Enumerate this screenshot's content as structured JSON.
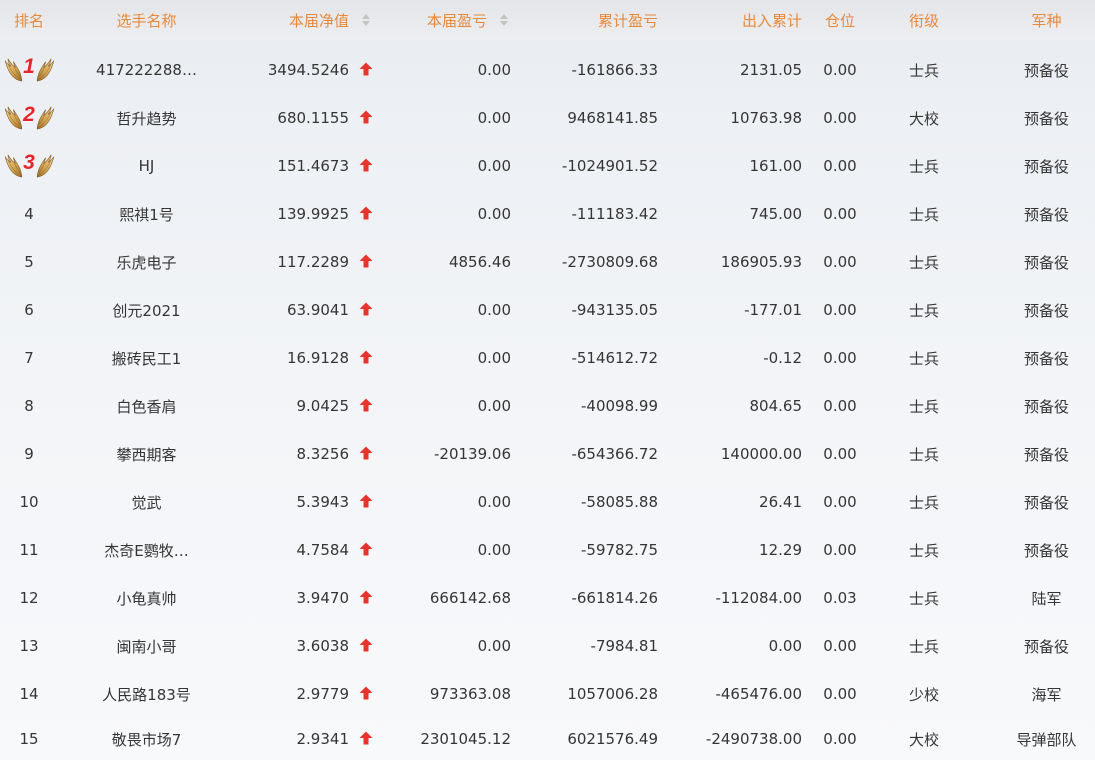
{
  "table": {
    "headers": [
      {
        "label": "排名"
      },
      {
        "label": "选手名称"
      },
      {
        "label": "本届净值",
        "sortable": true,
        "sort_icon": "sort-icon"
      },
      {
        "label": "本届盈亏",
        "sortable": true,
        "sort_icon": "sort-icon"
      },
      {
        "label": "累计盈亏"
      },
      {
        "label": "出入累计"
      },
      {
        "label": "仓位"
      },
      {
        "label": "衔级"
      },
      {
        "label": "军种"
      }
    ],
    "rows": [
      {
        "rank": "1",
        "rank_icon": "laurel-wings-icon",
        "name": "417222288…",
        "net_value": "3494.5246",
        "trend_icon": "up-arrow-icon",
        "period_pnl": "0.00",
        "total_pnl": "-161866.33",
        "in_out_total": "2131.05",
        "position": "0.00",
        "title": "士兵",
        "branch": "预备役"
      },
      {
        "rank": "2",
        "rank_icon": "laurel-wings-icon",
        "name": "哲升趋势",
        "net_value": "680.1155",
        "trend_icon": "up-arrow-icon",
        "period_pnl": "0.00",
        "total_pnl": "9468141.85",
        "in_out_total": "10763.98",
        "position": "0.00",
        "title": "大校",
        "branch": "预备役"
      },
      {
        "rank": "3",
        "rank_icon": "laurel-wings-icon",
        "name": "HJ",
        "net_value": "151.4673",
        "trend_icon": "up-arrow-icon",
        "period_pnl": "0.00",
        "total_pnl": "-1024901.52",
        "in_out_total": "161.00",
        "position": "0.00",
        "title": "士兵",
        "branch": "预备役"
      },
      {
        "rank": "4",
        "name": "熙祺1号",
        "net_value": "139.9925",
        "trend_icon": "up-arrow-icon",
        "period_pnl": "0.00",
        "total_pnl": "-111183.42",
        "in_out_total": "745.00",
        "position": "0.00",
        "title": "士兵",
        "branch": "预备役"
      },
      {
        "rank": "5",
        "name": "乐虎电子",
        "net_value": "117.2289",
        "trend_icon": "up-arrow-icon",
        "period_pnl": "4856.46",
        "total_pnl": "-2730809.68",
        "in_out_total": "186905.93",
        "position": "0.00",
        "title": "士兵",
        "branch": "预备役"
      },
      {
        "rank": "6",
        "name": "创元2021",
        "net_value": "63.9041",
        "trend_icon": "up-arrow-icon",
        "period_pnl": "0.00",
        "total_pnl": "-943135.05",
        "in_out_total": "-177.01",
        "position": "0.00",
        "title": "士兵",
        "branch": "预备役"
      },
      {
        "rank": "7",
        "name": "搬砖民工1",
        "net_value": "16.9128",
        "trend_icon": "up-arrow-icon",
        "period_pnl": "0.00",
        "total_pnl": "-514612.72",
        "in_out_total": "-0.12",
        "position": "0.00",
        "title": "士兵",
        "branch": "预备役"
      },
      {
        "rank": "8",
        "name": "白色香肩",
        "net_value": "9.0425",
        "trend_icon": "up-arrow-icon",
        "period_pnl": "0.00",
        "total_pnl": "-40098.99",
        "in_out_total": "804.65",
        "position": "0.00",
        "title": "士兵",
        "branch": "预备役"
      },
      {
        "rank": "9",
        "name": "攀西期客",
        "net_value": "8.3256",
        "trend_icon": "up-arrow-icon",
        "period_pnl": "-20139.06",
        "total_pnl": "-654366.72",
        "in_out_total": "140000.00",
        "position": "0.00",
        "title": "士兵",
        "branch": "预备役"
      },
      {
        "rank": "10",
        "name": "觉武",
        "net_value": "5.3943",
        "trend_icon": "up-arrow-icon",
        "period_pnl": "0.00",
        "total_pnl": "-58085.88",
        "in_out_total": "26.41",
        "position": "0.00",
        "title": "士兵",
        "branch": "预备役"
      },
      {
        "rank": "11",
        "name": "杰奇E鹦牧…",
        "net_value": "4.7584",
        "trend_icon": "up-arrow-icon",
        "period_pnl": "0.00",
        "total_pnl": "-59782.75",
        "in_out_total": "12.29",
        "position": "0.00",
        "title": "士兵",
        "branch": "预备役"
      },
      {
        "rank": "12",
        "name": "小龟真帅",
        "net_value": "3.9470",
        "trend_icon": "up-arrow-icon",
        "period_pnl": "666142.68",
        "total_pnl": "-661814.26",
        "in_out_total": "-112084.00",
        "position": "0.03",
        "title": "士兵",
        "branch": "陆军"
      },
      {
        "rank": "13",
        "name": "闽南小哥",
        "net_value": "3.6038",
        "trend_icon": "up-arrow-icon",
        "period_pnl": "0.00",
        "total_pnl": "-7984.81",
        "in_out_total": "0.00",
        "position": "0.00",
        "title": "士兵",
        "branch": "预备役"
      },
      {
        "rank": "14",
        "name": "人民路183号",
        "net_value": "2.9779",
        "trend_icon": "up-arrow-icon",
        "period_pnl": "973363.08",
        "total_pnl": "1057006.28",
        "in_out_total": "-465476.00",
        "position": "0.00",
        "title": "少校",
        "branch": "海军"
      },
      {
        "rank": "15",
        "name": "敬畏市场7",
        "net_value": "2.9341",
        "trend_icon": "up-arrow-icon",
        "period_pnl": "2301045.12",
        "total_pnl": "6021576.49",
        "in_out_total": "-2490738.00",
        "position": "0.00",
        "title": "大校",
        "branch": "导弹部队"
      }
    ]
  },
  "colors": {
    "header_text": "#e8893a",
    "body_text": "#353535",
    "rank_number": "#e4252b",
    "trend_up": "#e8342c",
    "sort_icon": "#c3c3c3",
    "wing_gold": "#d9ad5e"
  }
}
